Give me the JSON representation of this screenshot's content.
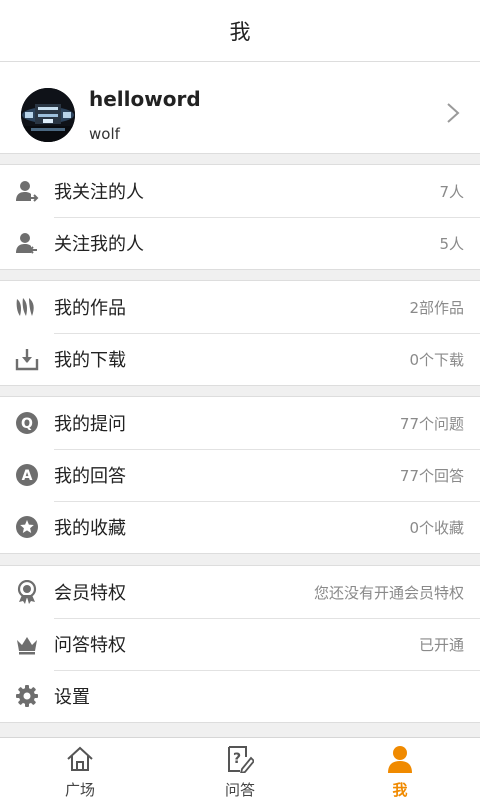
{
  "header": {
    "title": "我"
  },
  "profile": {
    "name": "helloword",
    "subtitle": "wolf"
  },
  "groups": [
    {
      "items": [
        {
          "icon": "user-following-icon",
          "label": "我关注的人",
          "value": "7人"
        },
        {
          "icon": "user-followers-icon",
          "label": "关注我的人",
          "value": "5人"
        }
      ]
    },
    {
      "items": [
        {
          "icon": "works-icon",
          "label": "我的作品",
          "value": "2部作品"
        },
        {
          "icon": "download-icon",
          "label": "我的下载",
          "value": "0个下载"
        }
      ]
    },
    {
      "items": [
        {
          "icon": "question-icon",
          "label": "我的提问",
          "value": "77个问题"
        },
        {
          "icon": "answer-icon",
          "label": "我的回答",
          "value": "77个回答"
        },
        {
          "icon": "star-icon",
          "label": "我的收藏",
          "value": "0个收藏"
        }
      ]
    },
    {
      "items": [
        {
          "icon": "award-icon",
          "label": "会员特权",
          "value": "您还没有开通会员特权"
        },
        {
          "icon": "crown-icon",
          "label": "问答特权",
          "value": "已开通"
        },
        {
          "icon": "gear-icon",
          "label": "设置",
          "value": ""
        }
      ]
    }
  ],
  "tabs": [
    {
      "icon": "home-icon",
      "label": "广场",
      "active": false
    },
    {
      "icon": "qa-icon",
      "label": "问答",
      "active": false
    },
    {
      "icon": "person-icon",
      "label": "我",
      "active": true
    }
  ],
  "colors": {
    "accent": "#f08a00",
    "icon_gray": "#6e6e6e",
    "value_gray": "#8a8a8a"
  }
}
